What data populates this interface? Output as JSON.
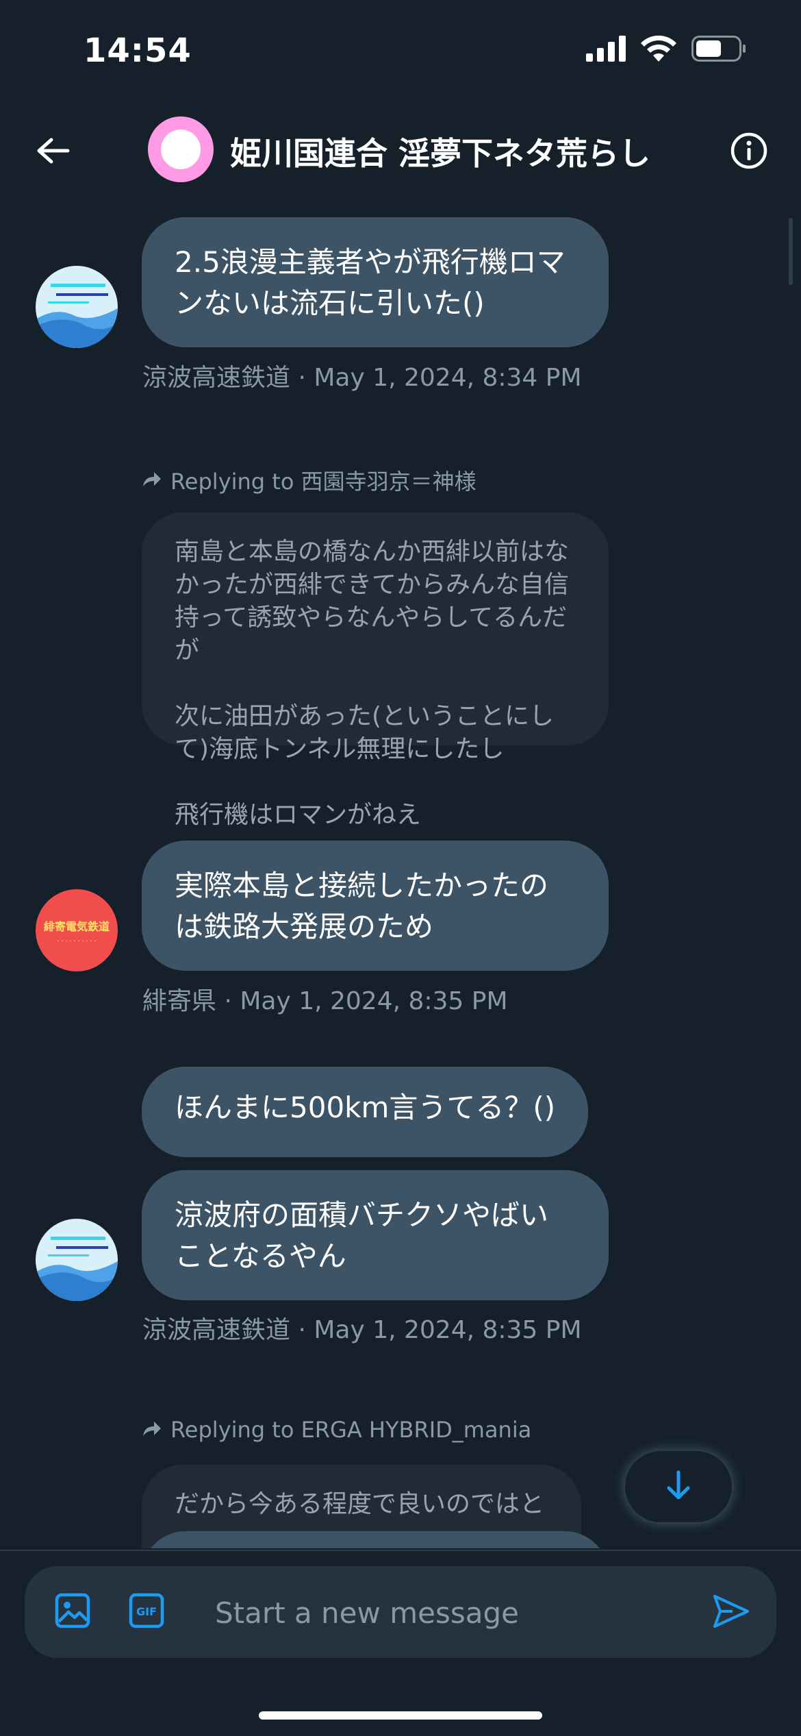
{
  "status_bar": {
    "time": "14:54",
    "icons": [
      "signal-icon",
      "wifi-icon",
      "battery-icon"
    ]
  },
  "header": {
    "title": "姫川国連合 淫夢下ネタ荒らし",
    "back_icon": "back-arrow-icon",
    "info_icon": "info-icon",
    "avatar_color": "#ff9be6"
  },
  "messages": [
    {
      "text": "2.5浪漫主義者やが飛行機ロマンないは流石に引いた()",
      "sender": "涼波高速鉄道",
      "timestamp": "May 1, 2024, 8:34 PM",
      "meta": "涼波高速鉄道 · May 1, 2024, 8:34 PM"
    },
    {
      "reply_label": "Replying to 西園寺羽京＝神様",
      "quoted_text": "南島と本島の橋なんか西緋以前はなかったが西緋できてからみんな自信持って誘致やらなんやらしてるんだが\n\n次に油田があった(ということにして)海底トンネル無理にしたし\n\n飛行機はロマンがねえ",
      "text": "実際本島と接続したかったのは鉄路大発展のため",
      "sender": "緋寄県",
      "timestamp": "May 1, 2024, 8:35 PM",
      "meta": "緋寄県 · May 1, 2024, 8:35 PM",
      "avatar_text": "緋寄電気鉄道"
    },
    {
      "texts": [
        "ほんまに500km言うてる？()",
        "涼波府の面積バチクソやばいことなるやん"
      ],
      "sender": "涼波高速鉄道",
      "timestamp": "May 1, 2024, 8:35 PM",
      "meta": "涼波高速鉄道 · May 1, 2024, 8:35 PM"
    },
    {
      "reply_label": "Replying to ERGA HYBRID_mania",
      "quoted_text": "だから今ある程度で良いのではと"
    }
  ],
  "composer": {
    "placeholder": "Start a new message",
    "media_icon": "image-icon",
    "gif_icon": "gif-icon",
    "send_icon": "send-icon"
  },
  "colors": {
    "background": "#15202b",
    "bubble": "#3d5466",
    "quoted_bubble": "#202b36",
    "accent": "#1d9bf0",
    "meta_text": "#8b98a5"
  }
}
